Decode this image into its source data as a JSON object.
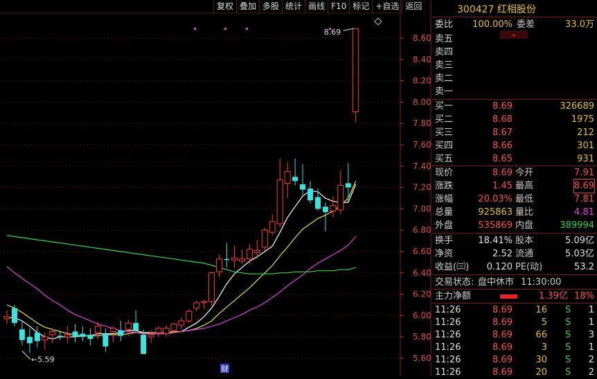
{
  "stock": {
    "code": "300427",
    "name": "红相股份"
  },
  "toolbar": [
    "复权",
    "叠加",
    "多股",
    "统计",
    "画线",
    "F10",
    "标记",
    "+自选",
    "返回"
  ],
  "order_ratio": {
    "label1": "委比",
    "val1": "100.00%",
    "label2": "委差",
    "val2": "33.0万"
  },
  "sell_levels": [
    "卖五",
    "卖四",
    "卖三",
    "卖二",
    "卖一"
  ],
  "buy_levels": [
    {
      "label": "买一",
      "price": "8.69",
      "vol": "326689"
    },
    {
      "label": "买二",
      "price": "8.68",
      "vol": "1975"
    },
    {
      "label": "买三",
      "price": "8.67",
      "vol": "212"
    },
    {
      "label": "买四",
      "price": "8.66",
      "vol": "301"
    },
    {
      "label": "买五",
      "price": "8.65",
      "vol": "931"
    }
  ],
  "quote": [
    {
      "l1": "现价",
      "v1": "8.69",
      "l2": "今开",
      "v2": "7.91"
    },
    {
      "l1": "涨跌",
      "v1": "1.45",
      "l2": "最高",
      "v2": "8.69"
    },
    {
      "l1": "涨幅",
      "v1": "20.03%",
      "l2": "最低",
      "v2": "7.81"
    },
    {
      "l1": "总量",
      "v1": "925863",
      "l2": "量比",
      "v2": "4.81"
    },
    {
      "l1": "外盘",
      "v1": "535869",
      "l2": "内盘",
      "v2": "389994"
    }
  ],
  "fundamentals": [
    {
      "l1": "换手",
      "v1": "18.41%",
      "l2": "股本",
      "v2": "5.09亿"
    },
    {
      "l1": "净资",
      "v1": "2.52",
      "l2": "流通",
      "v2": "5.03亿"
    },
    {
      "l1": "收益(㈢)",
      "v1": "0.120",
      "l2": "PE(动)",
      "v2": "53.2"
    }
  ],
  "status": {
    "label": "交易状态:",
    "state": "盘中休市",
    "time": "11:30:00"
  },
  "main_flow": {
    "label": "主力净额",
    "value": "1.39亿",
    "pct": "18%",
    "bar_fraction": 0.18
  },
  "ticks": [
    {
      "time": "11:26",
      "price": "8.69",
      "vol": "16",
      "side": "S",
      "count": "1"
    },
    {
      "time": "11:26",
      "price": "8.69",
      "vol": "5",
      "side": "S",
      "count": "1"
    },
    {
      "time": "11:26",
      "price": "8.69",
      "vol": "66",
      "side": "S",
      "count": "3"
    },
    {
      "time": "11:26",
      "price": "8.69",
      "vol": "3",
      "side": "S",
      "count": "1"
    },
    {
      "time": "11:26",
      "price": "8.69",
      "vol": "30",
      "side": "S",
      "count": "2"
    },
    {
      "time": "11:26",
      "price": "8.69",
      "vol": "20",
      "side": "S",
      "count": "2"
    }
  ],
  "chart_data": {
    "type": "candlestick",
    "y_ticks": [
      "8.60",
      "8.40",
      "8.20",
      "8.00",
      "7.80",
      "7.60",
      "7.40",
      "7.20",
      "7.00",
      "6.80",
      "6.60",
      "6.40",
      "6.20",
      "6.00",
      "5.80",
      "5.60"
    ],
    "ylim": [
      5.56,
      8.86
    ],
    "annotations": {
      "high_label": "8.69",
      "low_label": "5.59",
      "event_marker": "财"
    },
    "candles": [
      [
        5.97,
        6.05,
        5.92,
        5.99
      ],
      [
        6.07,
        6.1,
        5.9,
        5.93
      ],
      [
        5.87,
        5.95,
        5.72,
        5.77
      ],
      [
        5.8,
        5.88,
        5.65,
        5.74
      ],
      [
        5.84,
        5.9,
        5.7,
        5.76
      ],
      [
        5.77,
        5.84,
        5.68,
        5.8
      ],
      [
        5.82,
        5.88,
        5.74,
        5.85
      ],
      [
        5.81,
        5.86,
        5.77,
        5.8
      ],
      [
        5.8,
        5.9,
        5.74,
        5.82
      ],
      [
        5.85,
        5.92,
        5.75,
        5.8
      ],
      [
        5.83,
        5.9,
        5.76,
        5.8
      ],
      [
        5.82,
        5.88,
        5.72,
        5.78
      ],
      [
        5.84,
        5.94,
        5.78,
        5.9
      ],
      [
        5.83,
        5.88,
        5.66,
        5.71
      ],
      [
        5.85,
        5.9,
        5.75,
        5.88
      ],
      [
        5.86,
        5.95,
        5.76,
        5.81
      ],
      [
        5.87,
        5.96,
        5.81,
        5.93
      ],
      [
        5.93,
        6.05,
        5.84,
        5.86
      ],
      [
        5.82,
        5.87,
        5.66,
        5.64
      ],
      [
        5.8,
        5.86,
        5.74,
        5.82
      ],
      [
        5.84,
        5.9,
        5.8,
        5.88
      ],
      [
        5.83,
        5.91,
        5.8,
        5.88
      ],
      [
        5.86,
        5.93,
        5.83,
        5.92
      ],
      [
        5.91,
        5.98,
        5.87,
        5.95
      ],
      [
        5.95,
        6.06,
        5.93,
        6.04
      ],
      [
        6.07,
        6.14,
        6.04,
        6.12
      ],
      [
        6.12,
        6.15,
        6.06,
        6.13
      ],
      [
        6.13,
        6.41,
        6.09,
        6.4
      ],
      [
        6.41,
        6.57,
        6.36,
        6.53
      ],
      [
        6.53,
        6.68,
        6.45,
        6.52
      ],
      [
        6.52,
        6.65,
        6.45,
        6.54
      ],
      [
        6.51,
        6.62,
        6.48,
        6.53
      ],
      [
        6.53,
        6.67,
        6.48,
        6.62
      ],
      [
        6.59,
        6.71,
        6.54,
        6.61
      ],
      [
        6.64,
        6.82,
        6.61,
        6.8
      ],
      [
        6.78,
        6.95,
        6.75,
        6.88
      ],
      [
        6.86,
        7.47,
        6.83,
        7.27
      ],
      [
        7.24,
        7.44,
        7.1,
        7.35
      ],
      [
        7.3,
        7.47,
        7.22,
        7.26
      ],
      [
        7.23,
        7.42,
        7.13,
        7.18
      ],
      [
        7.19,
        7.26,
        7.05,
        7.08
      ],
      [
        7.11,
        7.19,
        6.98,
        7.0
      ],
      [
        7.02,
        7.06,
        6.79,
        6.97
      ],
      [
        6.98,
        7.12,
        6.92,
        7.03
      ],
      [
        6.99,
        7.36,
        6.95,
        7.22
      ],
      [
        7.24,
        7.43,
        7.07,
        7.2
      ],
      [
        7.91,
        8.69,
        7.81,
        8.69
      ]
    ],
    "ma_series": [
      {
        "color": "#ffffff",
        "values": [
          5.98,
          5.98,
          5.95,
          5.9,
          5.84,
          5.8,
          5.78,
          5.8,
          5.8,
          5.8,
          5.81,
          5.81,
          5.83,
          5.83,
          5.83,
          5.84,
          5.86,
          5.86,
          5.84,
          5.83,
          5.83,
          5.83,
          5.84,
          5.85,
          5.89,
          5.93,
          5.99,
          6.07,
          6.18,
          6.3,
          6.39,
          6.45,
          6.51,
          6.55,
          6.6,
          6.65,
          6.78,
          6.92,
          7.02,
          7.12,
          7.17,
          7.16,
          7.1,
          7.07,
          7.06,
          7.06,
          7.23
        ]
      },
      {
        "color": "#e5e542",
        "values": [
          6.1,
          6.07,
          6.03,
          5.98,
          5.93,
          5.89,
          5.87,
          5.85,
          5.83,
          5.82,
          5.81,
          5.81,
          5.81,
          5.82,
          5.82,
          5.82,
          5.83,
          5.84,
          5.84,
          5.84,
          5.84,
          5.84,
          5.85,
          5.85,
          5.86,
          5.88,
          5.91,
          5.95,
          6.02,
          6.08,
          6.14,
          6.2,
          6.26,
          6.33,
          6.4,
          6.47,
          6.56,
          6.64,
          6.73,
          6.81,
          6.86,
          6.91,
          6.94,
          6.98,
          7.03,
          7.1,
          7.26
        ]
      },
      {
        "color": "#e23ee2",
        "values": [
          6.46,
          6.4,
          6.35,
          6.3,
          6.25,
          6.19,
          6.14,
          6.1,
          6.05,
          6.01,
          5.98,
          5.95,
          5.92,
          5.9,
          5.88,
          5.86,
          5.85,
          5.84,
          5.83,
          5.83,
          5.83,
          5.83,
          5.84,
          5.85,
          5.86,
          5.87,
          5.88,
          5.9,
          5.92,
          5.95,
          5.98,
          6.01,
          6.05,
          6.08,
          6.12,
          6.17,
          6.22,
          6.28,
          6.33,
          6.38,
          6.44,
          6.49,
          6.53,
          6.57,
          6.61,
          6.66,
          6.74
        ]
      },
      {
        "color": "#37d94a",
        "values": [
          6.75,
          6.74,
          6.73,
          6.72,
          6.71,
          6.7,
          6.69,
          6.68,
          6.67,
          6.66,
          6.65,
          6.64,
          6.63,
          6.62,
          6.61,
          6.6,
          6.59,
          6.58,
          6.57,
          6.56,
          6.55,
          6.54,
          6.53,
          6.52,
          6.51,
          6.5,
          6.49,
          6.47,
          6.45,
          6.43,
          6.41,
          6.4,
          6.39,
          6.39,
          6.39,
          6.39,
          6.4,
          6.4,
          6.41,
          6.41,
          6.41,
          6.42,
          6.42,
          6.42,
          6.43,
          6.43,
          6.45
        ]
      }
    ]
  }
}
